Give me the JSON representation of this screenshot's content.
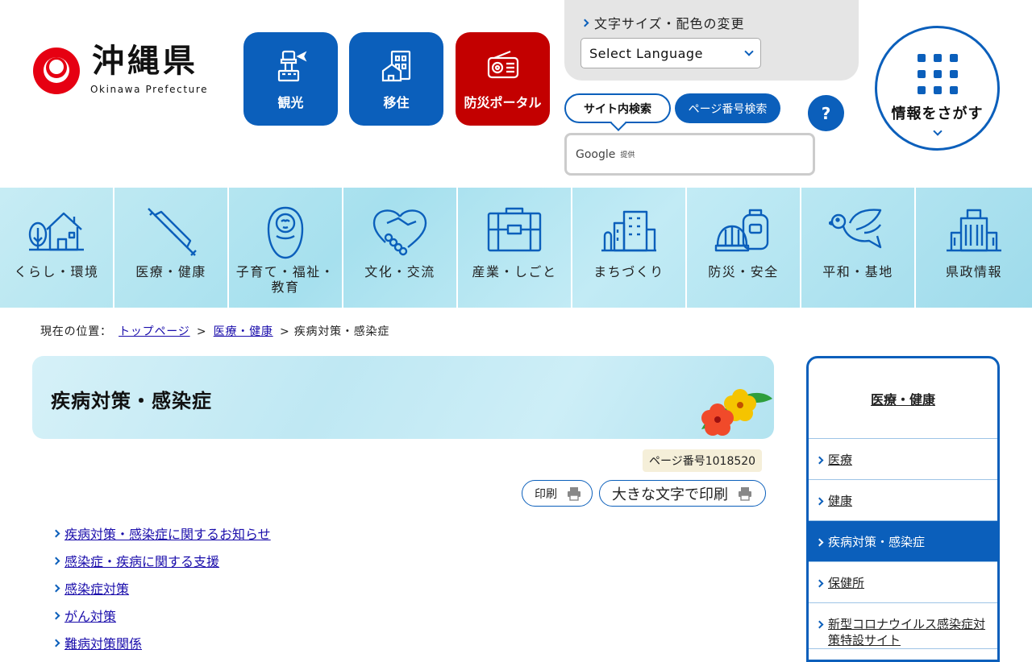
{
  "header": {
    "logo_name": "沖縄県",
    "logo_sub": "Okinawa Prefecture",
    "quick_links": [
      {
        "label": "観光",
        "icon": "control-tower-icon"
      },
      {
        "label": "移住",
        "icon": "house-building-icon"
      },
      {
        "label": "防災ポータル",
        "icon": "radio-icon"
      }
    ],
    "font_change_label": "文字サイズ・配色の変更",
    "language_select": "Select Language",
    "search_tabs": {
      "site": "サイト内検索",
      "page_number": "ページ番号検索"
    },
    "help_label": "?",
    "search_provider": "Google",
    "search_provider_suffix": "提供",
    "info_search_label": "情報をさがす"
  },
  "gnav": [
    {
      "label": "くらし・環境",
      "icon": "house-tree-icon"
    },
    {
      "label": "医療・健康",
      "icon": "syringe-icon"
    },
    {
      "label": "子育て・福祉・教育",
      "icon": "baby-icon"
    },
    {
      "label": "文化・交流",
      "icon": "handshake-heart-icon"
    },
    {
      "label": "産業・しごと",
      "icon": "briefcase-icon"
    },
    {
      "label": "まちづくり",
      "icon": "city-buildings-icon"
    },
    {
      "label": "防災・安全",
      "icon": "helmet-bag-icon"
    },
    {
      "label": "平和・基地",
      "icon": "dove-icon"
    },
    {
      "label": "県政情報",
      "icon": "government-building-icon"
    }
  ],
  "breadcrumb": {
    "prefix": "現在の位置：",
    "items": [
      "トップページ",
      "医療・健康"
    ],
    "separator": ">",
    "current": "疾病対策・感染症"
  },
  "main": {
    "title": "疾病対策・感染症",
    "page_number": "ページ番号1018520",
    "print_label": "印刷",
    "print_large_label": "大きな文字で印刷",
    "links": [
      "疾病対策・感染症に関するお知らせ",
      "感染症・疾病に関する支援",
      "感染症対策",
      "がん対策",
      "難病対策関係"
    ]
  },
  "side_menu": {
    "title": "医療・健康",
    "items": [
      "医療",
      "健康",
      "疾病対策・感染症",
      "保健所",
      "新型コロナウイルス感染症対策特設サイト"
    ],
    "active_index": 2
  },
  "colors": {
    "brand_blue": "#0b5fbb",
    "alert_red": "#c30000",
    "logo_red": "#e60012"
  }
}
